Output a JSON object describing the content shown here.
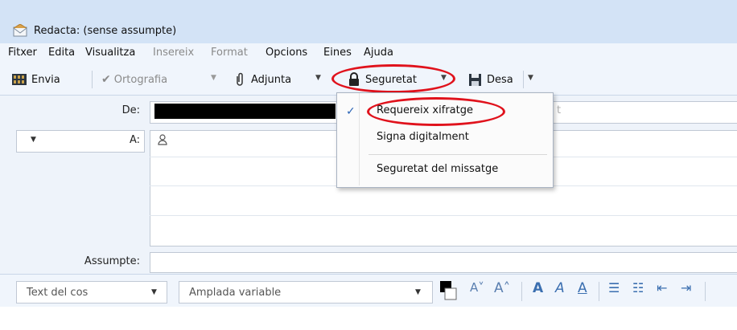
{
  "window": {
    "title": "Redacta: (sense assumpte)"
  },
  "menubar": {
    "items": [
      {
        "label": "Fitxer"
      },
      {
        "label": "Edita"
      },
      {
        "label": "Visualitza"
      },
      {
        "label": "Insereix"
      },
      {
        "label": "Format"
      },
      {
        "label": "Opcions"
      },
      {
        "label": "Eines"
      },
      {
        "label": "Ajuda"
      }
    ]
  },
  "toolbar": {
    "send_label": "Envia",
    "spelling_label": "Ortografia",
    "attach_label": "Adjunta",
    "security_label": "Seguretat",
    "save_label": "Desa"
  },
  "headers": {
    "from_label": "De:",
    "from_hint": "t",
    "to_label": "A:",
    "subject_label": "Assumpte:",
    "subject_value": ""
  },
  "security_menu": {
    "items": [
      {
        "label": "Requereix xifratge",
        "checked": true
      },
      {
        "label": "Signa digitalment",
        "checked": false
      },
      {
        "label": "Seguretat del missatge",
        "checked": false
      }
    ]
  },
  "format_toolbar": {
    "paragraph_style": "Text del cos",
    "font_family": "Amplada variable"
  },
  "icons": [
    "envelope-icon",
    "send-icon",
    "checkmark-icon",
    "paperclip-icon",
    "lock-icon",
    "save-icon",
    "person-icon",
    "color-swatch-icon"
  ],
  "colors": {
    "highlight_ring": "#e0121c",
    "titlebar": "#d3e3f6",
    "accent": "#3b6fb0"
  }
}
